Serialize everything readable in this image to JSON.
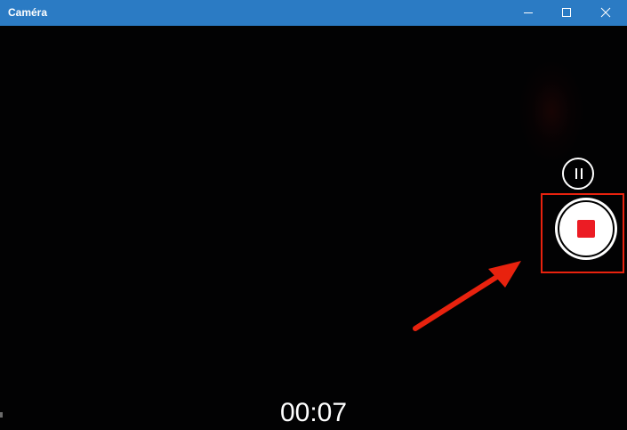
{
  "window": {
    "title": "Caméra",
    "titlebar_color": "#2b7bc4",
    "controls": [
      "minimize-icon",
      "maximize-icon",
      "close-icon"
    ]
  },
  "camera": {
    "timer": "00:07",
    "pause_icon": "pause-icon",
    "stop_icon": "stop-record-icon",
    "stop_color": "#ec1c24"
  },
  "annotation": {
    "color": "#e8220e",
    "shapes": [
      "highlight-box",
      "arrow"
    ]
  }
}
